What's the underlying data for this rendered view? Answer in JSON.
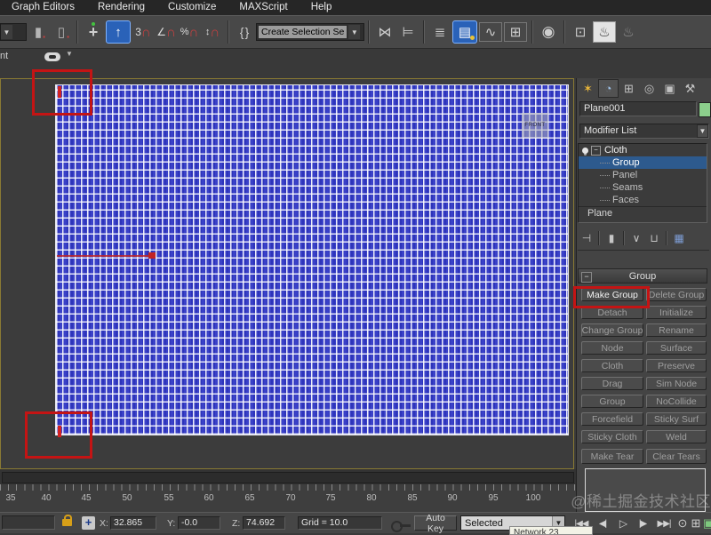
{
  "colors": {
    "accent_blue": "#2a62b8",
    "cloth_blue": "#3a41c8",
    "annotation_red": "#c41414",
    "object_color_swatch": "#8ccf8c",
    "stack_selection": "#2d5a8e"
  },
  "menu": {
    "items": [
      "Graph Editors",
      "Rendering",
      "Customize",
      "MAXScript",
      "Help"
    ]
  },
  "toolbar": {
    "selection_set_value": "Create Selection Se",
    "icons": [
      "selection-filter-dropdown",
      "select-by-name-icon",
      "selection-region-icon",
      "select-and-move-icon",
      "select-tool-active-icon",
      "snaps-toggle-3d-icon",
      "angle-snap-icon",
      "percent-snap-icon",
      "spinner-snap-icon",
      "named-selection-sets-icon",
      "mirror-icon",
      "align-icon",
      "layer-manager-icon",
      "graphite-ribbon-icon",
      "curve-editor-icon",
      "schematic-view-icon",
      "render-setup-icon",
      "rendered-frame-window-icon",
      "render-production-icon",
      "quick-render-icon"
    ]
  },
  "viewport": {
    "corner_label": "nt",
    "view_label": "FRONT"
  },
  "command_panel": {
    "tabs": [
      "create",
      "modify",
      "hierarchy",
      "motion",
      "display",
      "utilities"
    ],
    "object_name": "Plane001",
    "modifier_list_label": "Modifier List",
    "stack_items": [
      "Cloth",
      "Group",
      "Panel",
      "Seams",
      "Faces"
    ],
    "base_object": "Plane",
    "rollout_title": "Group",
    "group_buttons": [
      "Make Group",
      "Delete Group",
      "Detach",
      "Initialize",
      "Change Group",
      "Rename",
      "Node",
      "Surface",
      "Cloth",
      "Preserve",
      "Drag",
      "Sim Node",
      "Group",
      "NoCollide",
      "Forcefield",
      "Sticky Surf",
      "Sticky Cloth",
      "Weld"
    ],
    "tear_buttons": [
      "Make Tear",
      "Clear Tears"
    ]
  },
  "timeline": {
    "ticks": [
      "35",
      "40",
      "45",
      "50",
      "55",
      "60",
      "65",
      "70",
      "75",
      "80",
      "85",
      "90",
      "95",
      "100"
    ]
  },
  "status_bar": {
    "x_label": "X:",
    "x_value": "32.865",
    "y_label": "Y:",
    "y_value": "-0.0",
    "z_label": "Z:",
    "z_value": "74.692",
    "grid_label": "Grid = 10.0",
    "auto_key_label": "Auto Key",
    "selected_value": "Selected",
    "tooltip_fragment": "Network 23"
  },
  "watermark": "@稀土掘金技术社区"
}
